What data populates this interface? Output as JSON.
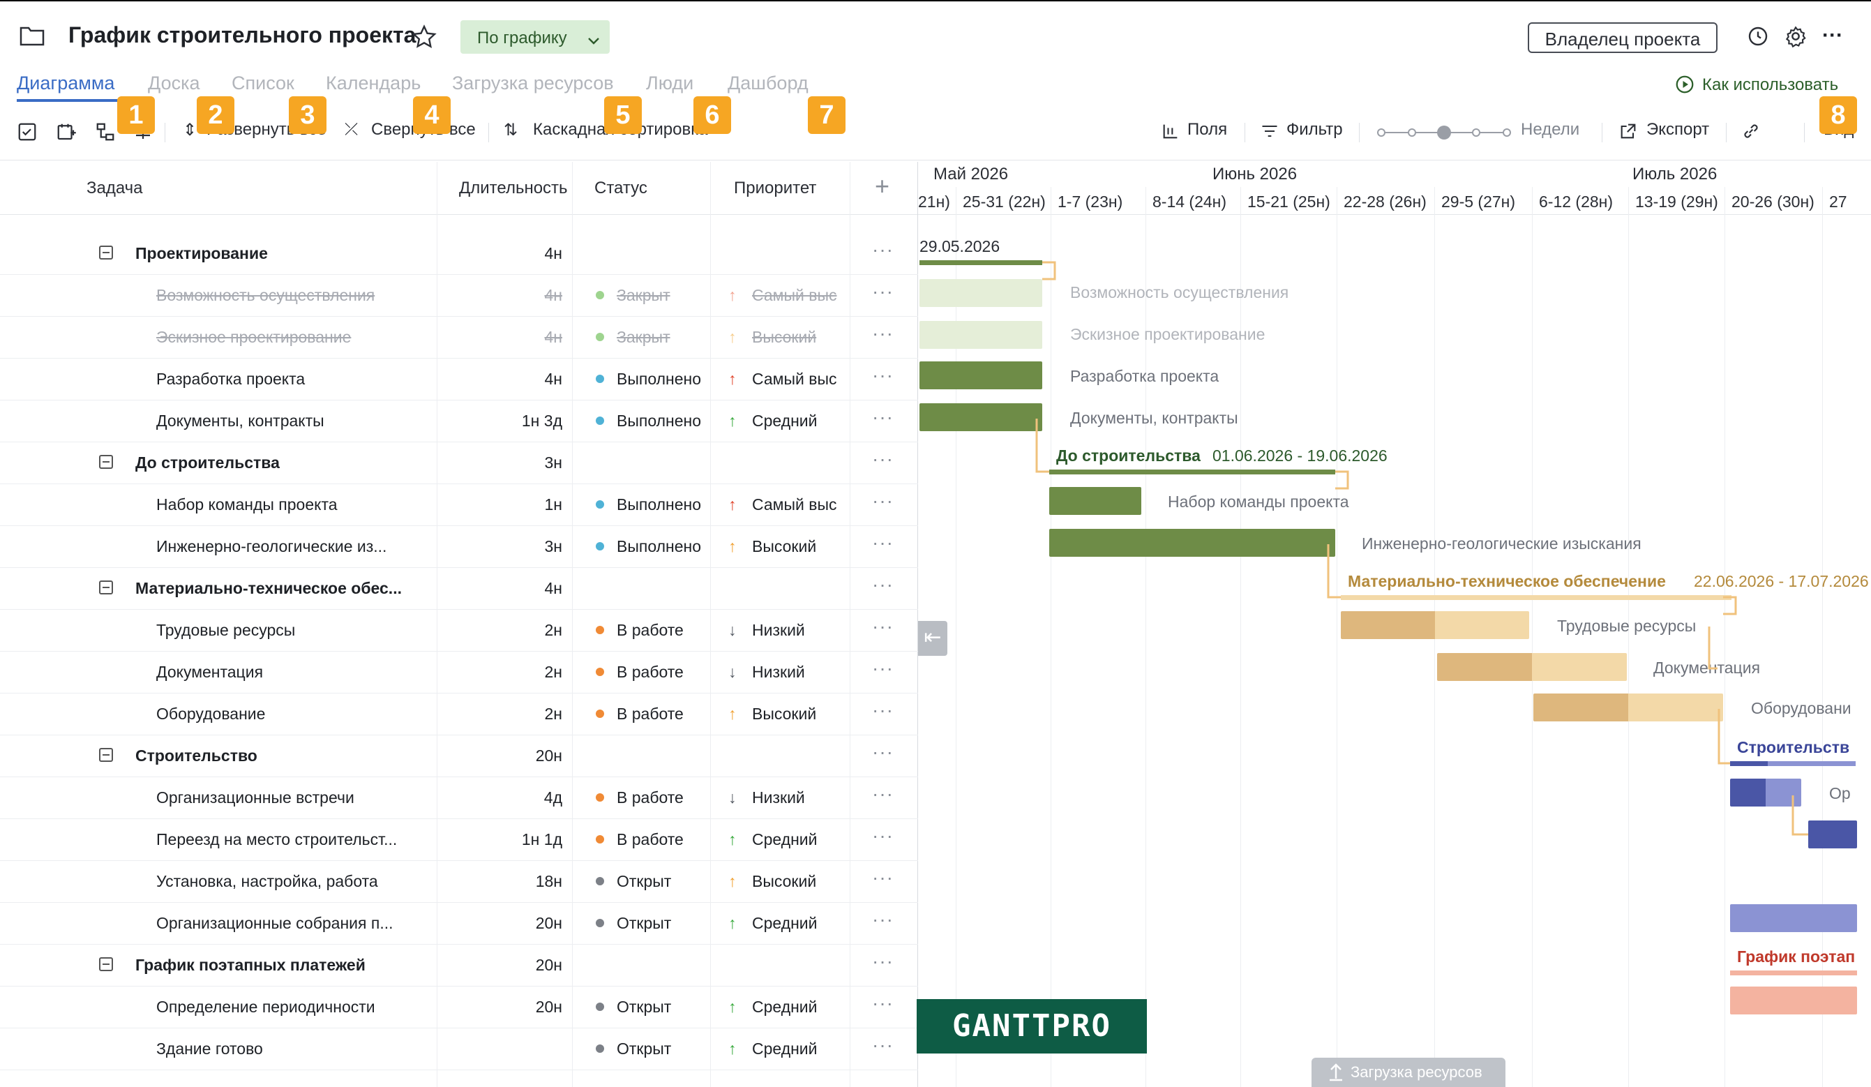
{
  "project": {
    "title": "График строительного проекта",
    "status": "По графику",
    "owner_button": "Владелец проекта"
  },
  "colors": {
    "accent": "#3a6cc5",
    "green_bar": "#6e8c47",
    "green_light": "#e5eed8",
    "tan_dark": "#deb77d",
    "tan_light": "#f3d9a8",
    "navy": "#4a56a6",
    "navy_light": "#8b93d3",
    "salmon": "#f4b3a0",
    "logo_bg": "#0e5c45"
  },
  "tabs": [
    "Диаграмма",
    "Доска",
    "Список",
    "Календарь",
    "Загрузка ресурсов",
    "Люди",
    "Дашборд"
  ],
  "how_to": "Как использовать",
  "toolbar": {
    "expand": "Развернуть все",
    "collapse": "Свернуть все",
    "cascade": "Каскадная сортировка",
    "fields": "Поля",
    "filter": "Фильтр",
    "weeks": "Недели",
    "export": "Экспорт",
    "view": "Вид"
  },
  "badges": [
    "1",
    "2",
    "3",
    "4",
    "5",
    "6",
    "7",
    "8"
  ],
  "columns": {
    "task": "Задача",
    "duration": "Длительность",
    "status": "Статус",
    "priority": "Приоритет",
    "add": "+"
  },
  "rows": [
    {
      "group": true,
      "name": "Проектирование",
      "duration": "4н",
      "status": "",
      "priority": ""
    },
    {
      "done": true,
      "name": "Возможность осуществления",
      "duration": "4н",
      "status": "Закрыт",
      "status_color": "#9ed48f",
      "priority": "Самый выс",
      "prio_arrow": "↑",
      "prio_color": "#f2a38f"
    },
    {
      "done": true,
      "name": "Эскизное проектирование",
      "duration": "4н",
      "status": "Закрыт",
      "status_color": "#9ed48f",
      "priority": "Высокий",
      "prio_arrow": "↑",
      "prio_color": "#f6cc8a"
    },
    {
      "name": "Разработка проекта",
      "duration": "4н",
      "status": "Выполнено",
      "status_color": "#4fb2d6",
      "priority": "Самый выс",
      "prio_arrow": "↑",
      "prio_color": "#e0442b"
    },
    {
      "name": "Документы, контракты",
      "duration": "1н 3д",
      "status": "Выполнено",
      "status_color": "#4fb2d6",
      "priority": "Средний",
      "prio_arrow": "↑",
      "prio_color": "#36a83a"
    },
    {
      "group": true,
      "name": "До строительства",
      "duration": "3н",
      "status": "",
      "priority": ""
    },
    {
      "name": "Набор команды проекта",
      "duration": "1н",
      "status": "Выполнено",
      "status_color": "#4fb2d6",
      "priority": "Самый выс",
      "prio_arrow": "↑",
      "prio_color": "#e0442b"
    },
    {
      "name": "Инженерно-геологические из...",
      "duration": "3н",
      "status": "Выполнено",
      "status_color": "#4fb2d6",
      "priority": "Высокий",
      "prio_arrow": "↑",
      "prio_color": "#f0a030"
    },
    {
      "group": true,
      "name": "Материально-техническое обес...",
      "duration": "4н",
      "status": "",
      "priority": ""
    },
    {
      "name": "Трудовые ресурсы",
      "duration": "2н",
      "status": "В работе",
      "status_color": "#f08a35",
      "priority": "Низкий",
      "prio_arrow": "↓",
      "prio_color": "#555a63"
    },
    {
      "name": "Документация",
      "duration": "2н",
      "status": "В работе",
      "status_color": "#f08a35",
      "priority": "Низкий",
      "prio_arrow": "↓",
      "prio_color": "#555a63"
    },
    {
      "name": "Оборудование",
      "duration": "2н",
      "status": "В работе",
      "status_color": "#f08a35",
      "priority": "Высокий",
      "prio_arrow": "↑",
      "prio_color": "#f0a030"
    },
    {
      "group": true,
      "name": "Строительство",
      "duration": "20н",
      "status": "",
      "priority": ""
    },
    {
      "name": "Организационные встречи",
      "duration": "4д",
      "status": "В работе",
      "status_color": "#f08a35",
      "priority": "Низкий",
      "prio_arrow": "↓",
      "prio_color": "#555a63"
    },
    {
      "name": "Переезд на место строительст...",
      "duration": "1н 1д",
      "status": "В работе",
      "status_color": "#f08a35",
      "priority": "Средний",
      "prio_arrow": "↑",
      "prio_color": "#36a83a"
    },
    {
      "name": "Установка, настройка, работа",
      "duration": "18н",
      "status": "Открыт",
      "status_color": "#7c8087",
      "priority": "Высокий",
      "prio_arrow": "↑",
      "prio_color": "#f0a030"
    },
    {
      "name": "Организационные собрания п...",
      "duration": "20н",
      "status": "Открыт",
      "status_color": "#7c8087",
      "priority": "Средний",
      "prio_arrow": "↑",
      "prio_color": "#36a83a"
    },
    {
      "group": true,
      "name": "График поэтапных платежей",
      "duration": "20н",
      "status": "",
      "priority": ""
    },
    {
      "name": "Определение периодичности",
      "duration": "20н",
      "status": "Открыт",
      "status_color": "#7c8087",
      "priority": "Средний",
      "prio_arrow": "↑",
      "prio_color": "#36a83a"
    },
    {
      "name": "Здание готово",
      "duration": "",
      "status": "Открыт",
      "status_color": "#7c8087",
      "priority": "Средний",
      "prio_arrow": "↑",
      "prio_color": "#36a83a"
    }
  ],
  "gantt": {
    "months": [
      "Май 2026",
      "Июнь 2026",
      "Июль 2026"
    ],
    "weeks": [
      "21н)",
      "25-31 (22н)",
      "1-7 (23н)",
      "8-14 (24н)",
      "15-21 (25н)",
      "22-28 (26н)",
      "29-5 (27н)",
      "6-12 (28н)",
      "13-19 (29н)",
      "20-26 (30н)",
      "27"
    ],
    "date_top": "29.05.2026",
    "labels": {
      "feas": "Возможность осуществления",
      "sketch": "Эскизное проектирование",
      "dev": "Разработка проекта",
      "docs": "Документы, контракты",
      "pre_name": "До строительства",
      "pre_dates": "01.06.2026 - 19.06.2026",
      "team": "Набор команды проекта",
      "geo": "Инженерно-геологические изыскания",
      "mat_name": "Материально-техническое обеспечение",
      "mat_dates": "22.06.2026 - 17.07.2026",
      "labor": "Трудовые ресурсы",
      "docs2": "Документация",
      "equip": "Оборудовани",
      "constr": "Строительств",
      "org": "Ор",
      "pay": "График поэтап"
    }
  },
  "logo": "GANTTPRO",
  "resources_panel": "Загрузка ресурсов"
}
